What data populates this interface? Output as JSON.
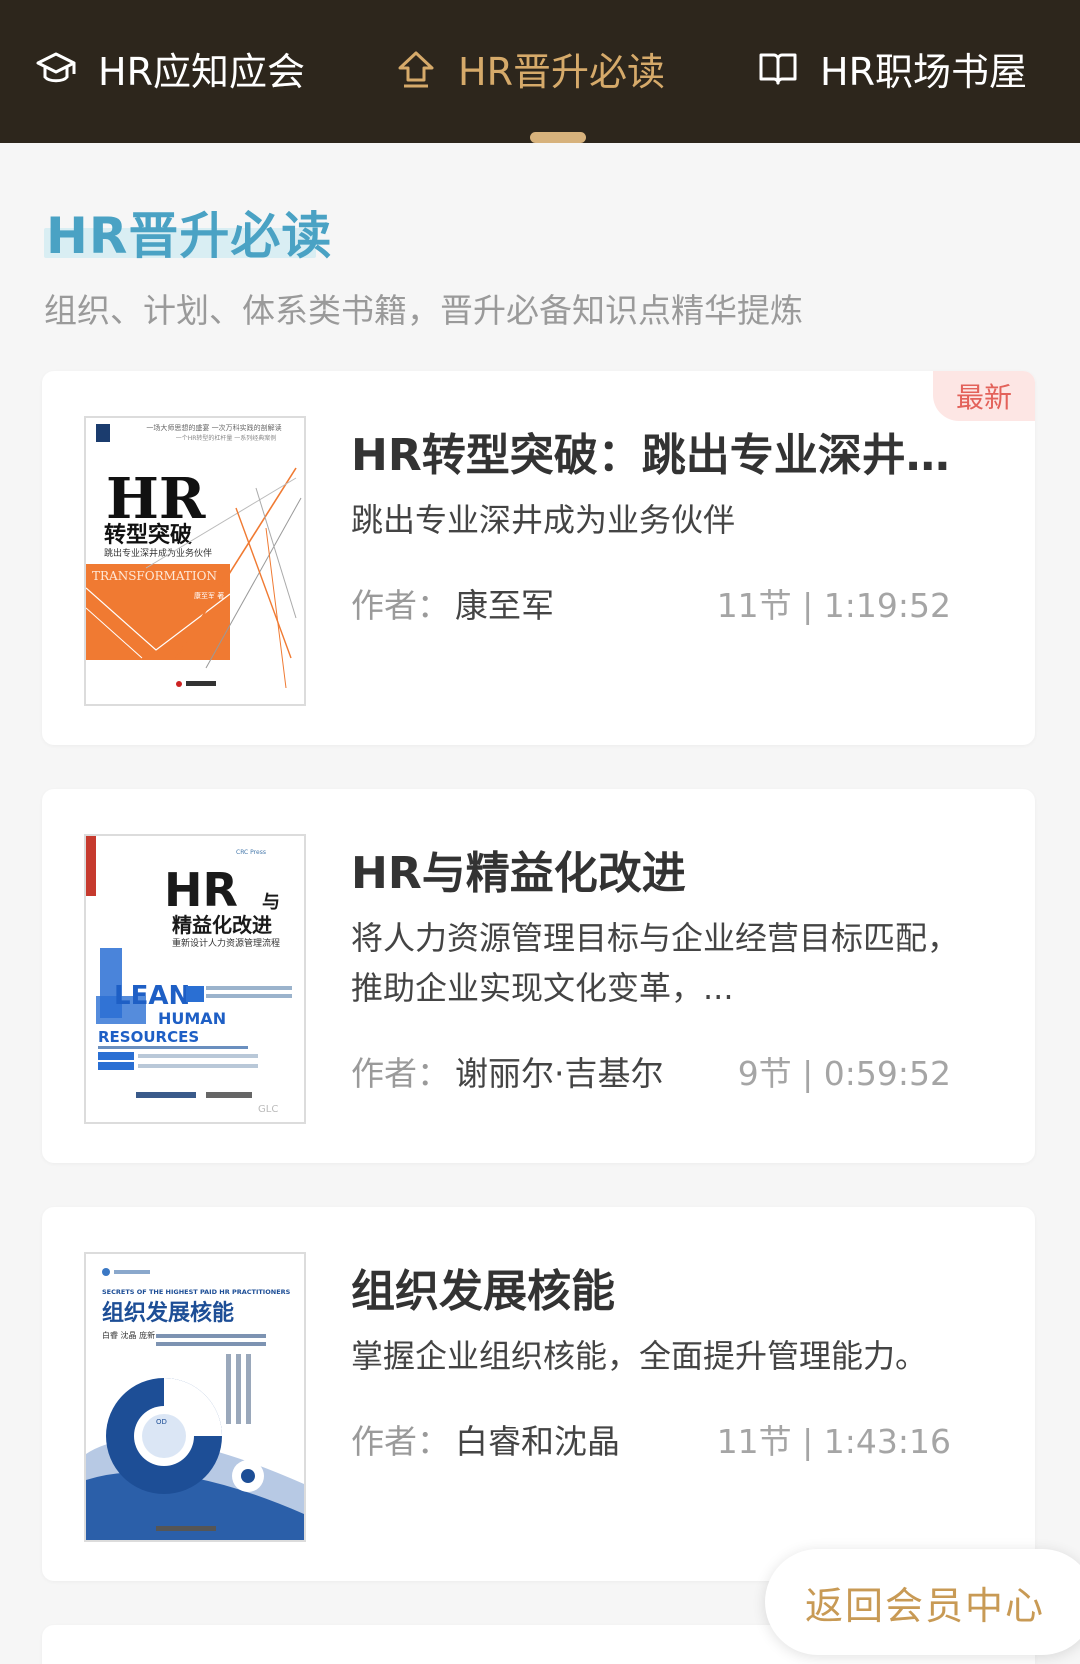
{
  "tabs": [
    {
      "label": "HR应知应会",
      "icon": "graduation-cap-icon",
      "active": false
    },
    {
      "label": "HR晋升必读",
      "icon": "arrow-up-icon",
      "active": true
    },
    {
      "label": "HR职场书屋",
      "icon": "book-icon",
      "active": false
    }
  ],
  "section": {
    "title": "HR晋升必读",
    "subtitle": "组织、计划、体系类书籍，晋升必备知识点精华提炼"
  },
  "books": [
    {
      "title": "HR转型突破：跳出专业深井成为业务伙伴",
      "desc": "跳出专业深井成为业务伙伴",
      "author_label": "作者：",
      "author": "康至军",
      "stats": "11节 | 1:19:52",
      "badge": "最新",
      "cover": {
        "top_text1": "一场大师思想的盛宴 一次万科实践的剖解读",
        "top_text2": "一个HR转型的杠杆量 一系列经典案例",
        "big": "HR",
        "title": "转型突破",
        "subtitle": "跳出专业深井成为业务伙伴",
        "banner": "TRANSFORMATION",
        "author": "康至军 著"
      }
    },
    {
      "title": "HR与精益化改进",
      "desc": "将人力资源管理目标与企业经营目标匹配，推助企业实现文化变革，...",
      "author_label": "作者：",
      "author": "谢丽尔·吉基尔",
      "stats": "9节 | 0:59:52",
      "cover": {
        "big": "HR",
        "and": "与",
        "title": "精益化改进",
        "subtitle": "重新设计人力资源管理流程",
        "lean": "LEAN",
        "human": "HUMAN",
        "resources": "RESOURCES"
      }
    },
    {
      "title": "组织发展核能",
      "desc": "掌握企业组织核能，全面提升管理能力。",
      "author_label": "作者：",
      "author": "白睿和沈晶",
      "stats": "11节 | 1:43:16",
      "cover": {
        "eyebrow": "SECRETS OF THE HIGHEST PAID HR PRACTITIONERS",
        "title": "组织发展核能",
        "authors": "白睿 沈晶 庞新",
        "od": "OD"
      }
    }
  ],
  "return_button": "返回会员中心",
  "colors": {
    "topbar": "#2d261c",
    "accent_gold": "#d6aa6a",
    "section_title": "#4aa2c4",
    "badge_bg": "#fde6e4",
    "badge_text": "#e3625a"
  }
}
